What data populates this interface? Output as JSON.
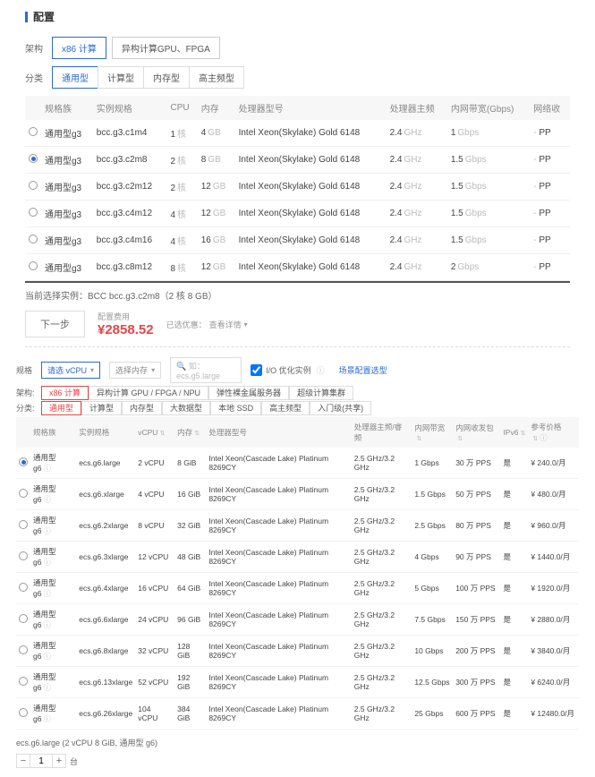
{
  "section1": {
    "header": "配置",
    "arch_label": "架构",
    "arch_tabs": [
      "x86 计算",
      "异构计算GPU、FPGA"
    ],
    "cat_label": "分类",
    "cat_tabs": [
      "通用型",
      "计算型",
      "内存型",
      "高主频型"
    ],
    "columns": [
      "规格族",
      "实例规格",
      "CPU",
      "内存",
      "处理器型号",
      "处理器主频",
      "内网带宽(Gbps)",
      "网络收"
    ],
    "rows": [
      {
        "sel": false,
        "family": "通用型g3",
        "spec": "bcc.g3.c1m4",
        "cpu": "1",
        "mem": "4",
        "proc": "Intel Xeon(Skylake) Gold 6148",
        "freq": "2.4",
        "bw": "1",
        "net": "PP"
      },
      {
        "sel": true,
        "family": "通用型g3",
        "spec": "bcc.g3.c2m8",
        "cpu": "2",
        "mem": "8",
        "proc": "Intel Xeon(Skylake) Gold 6148",
        "freq": "2.4",
        "bw": "1.5",
        "net": "PP"
      },
      {
        "sel": false,
        "family": "通用型g3",
        "spec": "bcc.g3.c2m12",
        "cpu": "2",
        "mem": "12",
        "proc": "Intel Xeon(Skylake) Gold 6148",
        "freq": "2.4",
        "bw": "1.5",
        "net": "PP"
      },
      {
        "sel": false,
        "family": "通用型g3",
        "spec": "bcc.g3.c4m12",
        "cpu": "4",
        "mem": "12",
        "proc": "Intel Xeon(Skylake) Gold 6148",
        "freq": "2.4",
        "bw": "1.5",
        "net": "PP"
      },
      {
        "sel": false,
        "family": "通用型g3",
        "spec": "bcc.g3.c4m16",
        "cpu": "4",
        "mem": "16",
        "proc": "Intel Xeon(Skylake) Gold 6148",
        "freq": "2.4",
        "bw": "1.5",
        "net": "PP"
      },
      {
        "sel": false,
        "family": "通用型g3",
        "spec": "bcc.g3.c8m12",
        "cpu": "8",
        "mem": "12",
        "proc": "Intel Xeon(Skylake) Gold 6148",
        "freq": "2.4",
        "bw": "2",
        "net": "PP"
      }
    ],
    "units": {
      "cpu": "核",
      "mem": "GB",
      "freq": "GHz",
      "bw": "Gbps"
    },
    "summary": "当前选择实例：BCC bcc.g3.c2m8（2 核 8 GB）",
    "next": "下一步",
    "price_label": "配置费用",
    "price": "¥2858.52",
    "discount_label": "已选优惠：",
    "discount_action": "查看详情"
  },
  "section2": {
    "spec_label": "规格",
    "dd_vcpu": "请选 vCPU",
    "dd_mem": "选择内存",
    "search_ph": "如：ecs.g5.large",
    "opt_io": "I/O 优化实例",
    "scene_link": "场景配置选型",
    "arch_label": "架构:",
    "arch_tabs": [
      "x86 计算",
      "异构计算 GPU / FPGA / NPU",
      "弹性裸金属服务器",
      "超级计算集群"
    ],
    "cat_label": "分类:",
    "cat_tabs": [
      "通用型",
      "计算型",
      "内存型",
      "大数据型",
      "本地 SSD",
      "高主频型",
      "入门级(共享)"
    ],
    "columns": [
      "规格族",
      "实例规格",
      "vCPU",
      "内存",
      "处理器型号",
      "处理器主频/睿频",
      "内网带宽",
      "内网收发包",
      "IPv6",
      "参考价格"
    ],
    "rows": [
      {
        "sel": true,
        "family": "通用型 g6",
        "spec": "ecs.g6.large",
        "vcpu": "2 vCPU",
        "mem": "8 GiB",
        "proc": "Intel Xeon(Cascade Lake) Platinum 8269CY",
        "freq": "2.5 GHz/3.2 GHz",
        "bw": "1 Gbps",
        "pps": "30 万 PPS",
        "ipv6": "是",
        "price": "¥ 240.0/月"
      },
      {
        "sel": false,
        "family": "通用型 g6",
        "spec": "ecs.g6.xlarge",
        "vcpu": "4 vCPU",
        "mem": "16 GiB",
        "proc": "Intel Xeon(Cascade Lake) Platinum 8269CY",
        "freq": "2.5 GHz/3.2 GHz",
        "bw": "1.5 Gbps",
        "pps": "50 万 PPS",
        "ipv6": "是",
        "price": "¥ 480.0/月"
      },
      {
        "sel": false,
        "family": "通用型 g6",
        "spec": "ecs.g6.2xlarge",
        "vcpu": "8 vCPU",
        "mem": "32 GiB",
        "proc": "Intel Xeon(Cascade Lake) Platinum 8269CY",
        "freq": "2.5 GHz/3.2 GHz",
        "bw": "2.5 Gbps",
        "pps": "80 万 PPS",
        "ipv6": "是",
        "price": "¥ 960.0/月"
      },
      {
        "sel": false,
        "family": "通用型 g6",
        "spec": "ecs.g6.3xlarge",
        "vcpu": "12 vCPU",
        "mem": "48 GiB",
        "proc": "Intel Xeon(Cascade Lake) Platinum 8269CY",
        "freq": "2.5 GHz/3.2 GHz",
        "bw": "4 Gbps",
        "pps": "90 万 PPS",
        "ipv6": "是",
        "price": "¥ 1440.0/月"
      },
      {
        "sel": false,
        "family": "通用型 g6",
        "spec": "ecs.g6.4xlarge",
        "vcpu": "16 vCPU",
        "mem": "64 GiB",
        "proc": "Intel Xeon(Cascade Lake) Platinum 8269CY",
        "freq": "2.5 GHz/3.2 GHz",
        "bw": "5 Gbps",
        "pps": "100 万 PPS",
        "ipv6": "是",
        "price": "¥ 1920.0/月"
      },
      {
        "sel": false,
        "family": "通用型 g6",
        "spec": "ecs.g6.6xlarge",
        "vcpu": "24 vCPU",
        "mem": "96 GiB",
        "proc": "Intel Xeon(Cascade Lake) Platinum 8269CY",
        "freq": "2.5 GHz/3.2 GHz",
        "bw": "7.5 Gbps",
        "pps": "150 万 PPS",
        "ipv6": "是",
        "price": "¥ 2880.0/月"
      },
      {
        "sel": false,
        "family": "通用型 g6",
        "spec": "ecs.g6.8xlarge",
        "vcpu": "32 vCPU",
        "mem": "128 GiB",
        "proc": "Intel Xeon(Cascade Lake) Platinum 8269CY",
        "freq": "2.5 GHz/3.2 GHz",
        "bw": "10 Gbps",
        "pps": "200 万 PPS",
        "ipv6": "是",
        "price": "¥ 3840.0/月"
      },
      {
        "sel": false,
        "family": "通用型 g6",
        "spec": "ecs.g6.13xlarge",
        "vcpu": "52 vCPU",
        "mem": "192 GiB",
        "proc": "Intel Xeon(Cascade Lake) Platinum 8269CY",
        "freq": "2.5 GHz/3.2 GHz",
        "bw": "12.5 Gbps",
        "pps": "300 万 PPS",
        "ipv6": "是",
        "price": "¥ 6240.0/月"
      },
      {
        "sel": false,
        "family": "通用型 g6",
        "spec": "ecs.g6.26xlarge",
        "vcpu": "104 vCPU",
        "mem": "384 GiB",
        "proc": "Intel Xeon(Cascade Lake) Platinum 8269CY",
        "freq": "2.5 GHz/3.2 GHz",
        "bw": "25 Gbps",
        "pps": "600 万 PPS",
        "ipv6": "是",
        "price": "¥ 12480.0/月"
      }
    ],
    "selinfo": "ecs.g6.large (2 vCPU 8 GiB, 通用型 g6)",
    "qty_label": "台",
    "qty": "1"
  }
}
